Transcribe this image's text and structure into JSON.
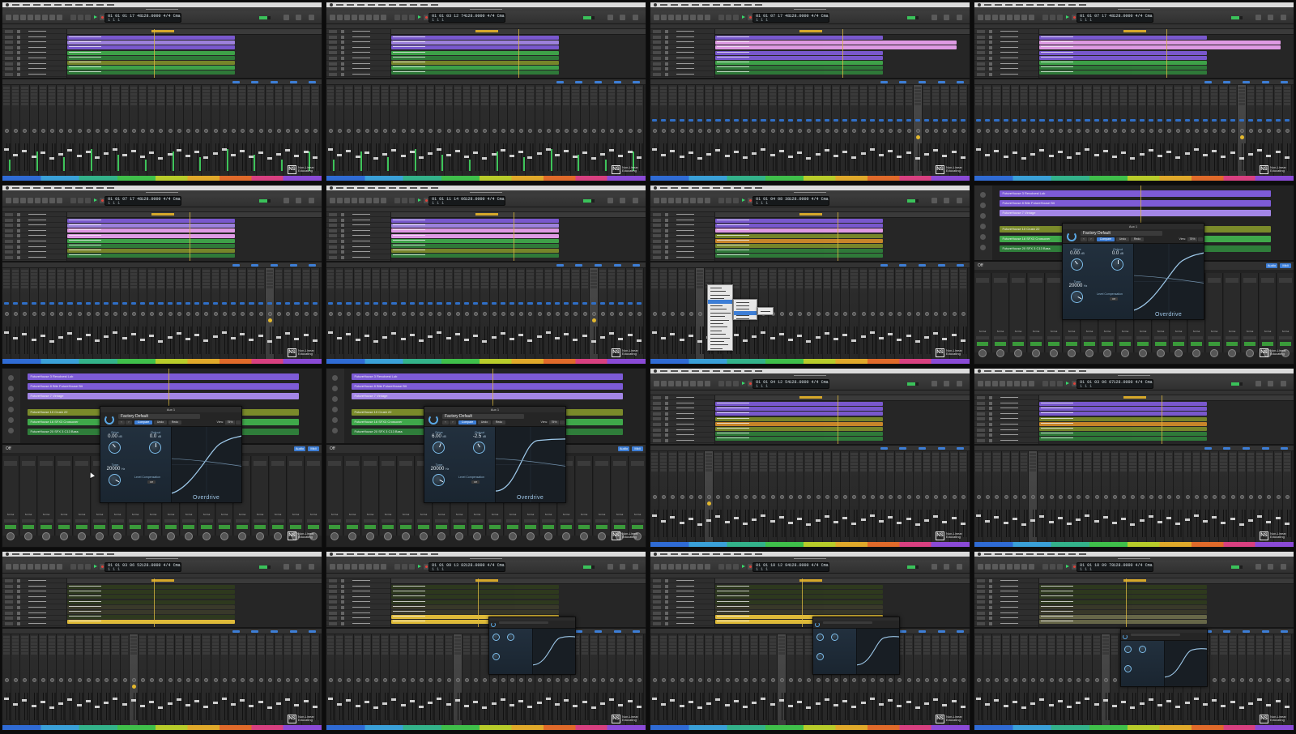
{
  "app": {
    "menu_items": 10,
    "brand_mark": "NS",
    "brand_text": "Non-Linear Educating"
  },
  "colors": {
    "purple": "#7d5bd6",
    "purple_light": "#a386e6",
    "pink": "#e8a0ee",
    "green_dark": "#2f7d3a",
    "green": "#3fa84a",
    "olive": "#7a8a2a",
    "orange": "#d08a2a",
    "yellow": "#e8c23a",
    "accent_blue": "#3d7ed6"
  },
  "lcd": {
    "f1": {
      "pos": "01 01 01 17 48",
      "beat": "1 1 1",
      "tempo": "128.0000",
      "sig": "4/4",
      "key": "Cmaj"
    },
    "f2": {
      "pos": "01 01 03 12 74",
      "beat": "1 1 1",
      "tempo": "128.0000",
      "sig": "4/4",
      "key": "Cmaj"
    },
    "f3": {
      "pos": "01 01 07 17 48",
      "beat": "1 1 1",
      "tempo": "128.0000",
      "sig": "4/4",
      "key": "Cmaj"
    },
    "f4": {
      "pos": "01 01 07 17 48",
      "beat": "1 1 1",
      "tempo": "128.0000",
      "sig": "4/4",
      "key": "Cmaj"
    },
    "f5": {
      "pos": "01 01 07 17 48",
      "beat": "1 1 1",
      "tempo": "128.0000",
      "sig": "4/4",
      "key": "Cmaj"
    },
    "f6": {
      "pos": "01 01 11 14 06",
      "beat": "1 1 1",
      "tempo": "128.0000",
      "sig": "4/4",
      "key": "Cmaj"
    },
    "f7": {
      "pos": "01 01 04 08 38",
      "beat": "1 1 1",
      "tempo": "128.0000",
      "sig": "4/4",
      "key": "Cmaj"
    },
    "f11": {
      "pos": "01 01 04 12 54",
      "beat": "1 1 1",
      "tempo": "128.0000",
      "sig": "4/4",
      "key": "Cmaj"
    },
    "f12": {
      "pos": "01 01 03 06 07",
      "beat": "1 1 1",
      "tempo": "128.0000",
      "sig": "4/4",
      "key": "Cmaj"
    },
    "f13": {
      "pos": "01 01 03 06 52",
      "beat": "1 1 1",
      "tempo": "128.0000",
      "sig": "4/4",
      "key": "Cmaj"
    },
    "f14": {
      "pos": "01 01 09 13 82",
      "beat": "1 1 1",
      "tempo": "128.0000",
      "sig": "4/4",
      "key": "Cmaj"
    },
    "f15": {
      "pos": "01 01 10 12 94",
      "beat": "1 1 1",
      "tempo": "128.0000",
      "sig": "4/4",
      "key": "Cmaj"
    },
    "f16": {
      "pos": "01 01 10 09 78",
      "beat": "1 1 1",
      "tempo": "128.0000",
      "sig": "4/4",
      "key": "Cmaj"
    }
  },
  "plugin_full_a": {
    "title": "Aux 1",
    "preset": "Factory Default",
    "compare": "Compare",
    "undo": "Undo",
    "redo": "Redo",
    "view_label": "View:",
    "view_value": "75%",
    "drive_label": "Drive",
    "drive_value": "0.00",
    "drive_unit": "dB",
    "output_label": "Output",
    "output_value": "0.0",
    "output_unit": "dB",
    "tone_label": "Tone",
    "tone_value": "20000",
    "tone_unit": "Hz",
    "level_comp": "Level Compensation",
    "level_btn": "Off",
    "name": "Overdrive"
  },
  "plugin_full_b": {
    "title": "Aux 1",
    "preset": "Factory Default",
    "compare": "Compare",
    "undo": "Undo",
    "redo": "Redo",
    "view_label": "View:",
    "view_value": "75%",
    "drive_label": "Drive",
    "drive_value": "6.00",
    "drive_unit": "dB",
    "output_label": "Output",
    "output_value": "-2.5",
    "output_unit": "dB",
    "tone_label": "Tone",
    "tone_value": "20000",
    "tone_unit": "Hz",
    "level_comp": "Level Compensation",
    "level_btn": "Off",
    "name": "Overdrive"
  },
  "plugin_full_c": {
    "title": "Aux 1",
    "preset": "Factory Default",
    "compare": "Compare",
    "undo": "Undo",
    "redo": "Redo",
    "view_label": "View:",
    "view_value": "75%",
    "drive_label": "Drive",
    "drive_value": "0.00",
    "drive_unit": "dB",
    "output_label": "Output",
    "output_value": "0.0",
    "output_unit": "dB",
    "tone_label": "Tone",
    "tone_value": "20000",
    "tone_unit": "Hz",
    "level_comp": "Level Compensation",
    "level_btn": "Off",
    "name": "Overdrive"
  },
  "zoom_regions": {
    "r1": "FutureHouse 3 Revolvest Lub",
    "r2": "FutureHouse 8 Bite FutureHouse Bit",
    "r3": "FutureHouse 7 Vintage",
    "r4": "FutureHouse 10 Crush 22",
    "r5": "FutureHouse 16 SFX3 Crossover",
    "r6": "FutureHouse 20 SFX 3 C13 Bass"
  },
  "zoom_mixer": {
    "label": "Off",
    "audio": "Audio",
    "midi": "Midi",
    "bus": "Bus 1",
    "out": "St Out",
    "read": "Read"
  }
}
